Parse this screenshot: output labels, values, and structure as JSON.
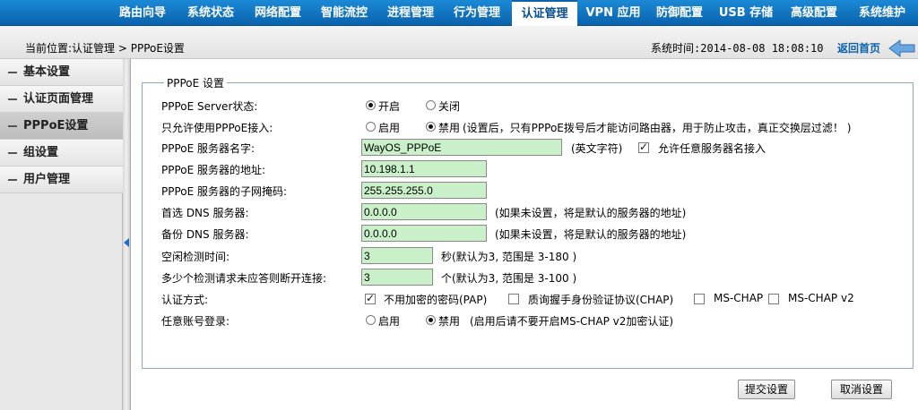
{
  "nav": {
    "items": [
      {
        "label": "路由向导"
      },
      {
        "label": "系统状态"
      },
      {
        "label": "网络配置"
      },
      {
        "label": "智能流控"
      },
      {
        "label": "进程管理"
      },
      {
        "label": "行为管理"
      },
      {
        "label": "认证管理",
        "active": true
      },
      {
        "label": "VPN 应用"
      },
      {
        "label": "防御配置"
      },
      {
        "label": "USB 存储"
      },
      {
        "label": "高级配置"
      },
      {
        "label": "系统维护"
      }
    ]
  },
  "breadcrumb": "当前位置:认证管理 > PPPoE设置",
  "system_time": "系统时间:2014-08-08 18:08:10",
  "home_link": "返回首页",
  "sidebar": {
    "items": [
      {
        "label": "基本设置"
      },
      {
        "label": "认证页面管理"
      },
      {
        "label": "PPPoE设置",
        "active": true
      },
      {
        "label": "组设置"
      },
      {
        "label": "用户管理"
      }
    ]
  },
  "form": {
    "legend": "PPPoE 设置",
    "server_status": {
      "label": "PPPoE Server状态:",
      "on": "开启",
      "off": "关闭",
      "value": "on"
    },
    "pppoe_only": {
      "label": "只允许使用PPPoE接入:",
      "enable": "启用",
      "disable": "禁用",
      "value": "disable",
      "note": "(设置后，只有PPPoE拨号后才能访问路由器，用于防止攻击，真正交换层过滤！ )"
    },
    "server_name": {
      "label": "PPPoE 服务器名字:",
      "value": "WayOS_PPPoE",
      "hint": "(英文字符)",
      "allow_any_label": "允许任意服务器名接入",
      "allow_any_checked": true
    },
    "server_addr": {
      "label": "PPPoE 服务器的地址:",
      "value": "10.198.1.1"
    },
    "subnet_mask": {
      "label": "PPPoE 服务器的子网掩码:",
      "value": "255.255.255.0"
    },
    "primary_dns": {
      "label": "首选 DNS 服务器:",
      "value": "0.0.0.0",
      "hint": "(如果未设置，将是默认的服务器的地址)"
    },
    "backup_dns": {
      "label": "备份 DNS 服务器:",
      "value": "0.0.0.0",
      "hint": "(如果未设置，将是默认的服务器的地址)"
    },
    "idle_check": {
      "label": "空闲检测时间:",
      "value": "3",
      "hint": "秒(默认为3, 范围是 3-180 )"
    },
    "echo_fail": {
      "label": "多少个检测请求未应答则断开连接:",
      "value": "3",
      "hint": "个(默认为3, 范围是 3-100 )"
    },
    "auth": {
      "label": "认证方式:",
      "options": [
        {
          "label": "不用加密的密码(PAP)",
          "checked": true
        },
        {
          "label": "质询握手身份验证协议(CHAP)",
          "checked": false
        },
        {
          "label": "MS-CHAP",
          "checked": false
        },
        {
          "label": "MS-CHAP v2",
          "checked": false
        }
      ]
    },
    "any_account": {
      "label": "任意账号登录:",
      "enable": "启用",
      "disable": "禁用",
      "value": "disable",
      "note": "(启用后请不要开启MS-CHAP v2加密认证)"
    }
  },
  "buttons": {
    "submit": "提交设置",
    "cancel": "取消设置"
  },
  "colors": {
    "nav_bg": "#0a62ad",
    "input_bg": "#c9f0c9",
    "panel_border": "#8aa6c8"
  }
}
